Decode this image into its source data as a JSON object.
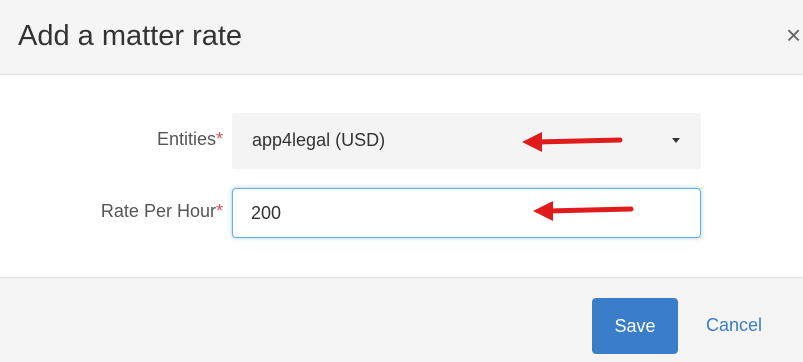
{
  "dialog": {
    "title": "Add a matter rate",
    "close_glyph": "×"
  },
  "form": {
    "entities": {
      "label": "Entities",
      "required_mark": "*",
      "selected_value": "app4legal (USD)"
    },
    "rate_per_hour": {
      "label": "Rate Per Hour",
      "required_mark": "*",
      "value": "200"
    }
  },
  "footer": {
    "save_label": "Save",
    "cancel_label": "Cancel"
  },
  "colors": {
    "annotation_arrow": "#e01b1b",
    "primary": "#3a7dc9",
    "required": "#d9534f"
  },
  "icons": {
    "close": "close-icon",
    "dropdown": "chevron-down-icon",
    "annotation": "red-arrow-icon"
  }
}
